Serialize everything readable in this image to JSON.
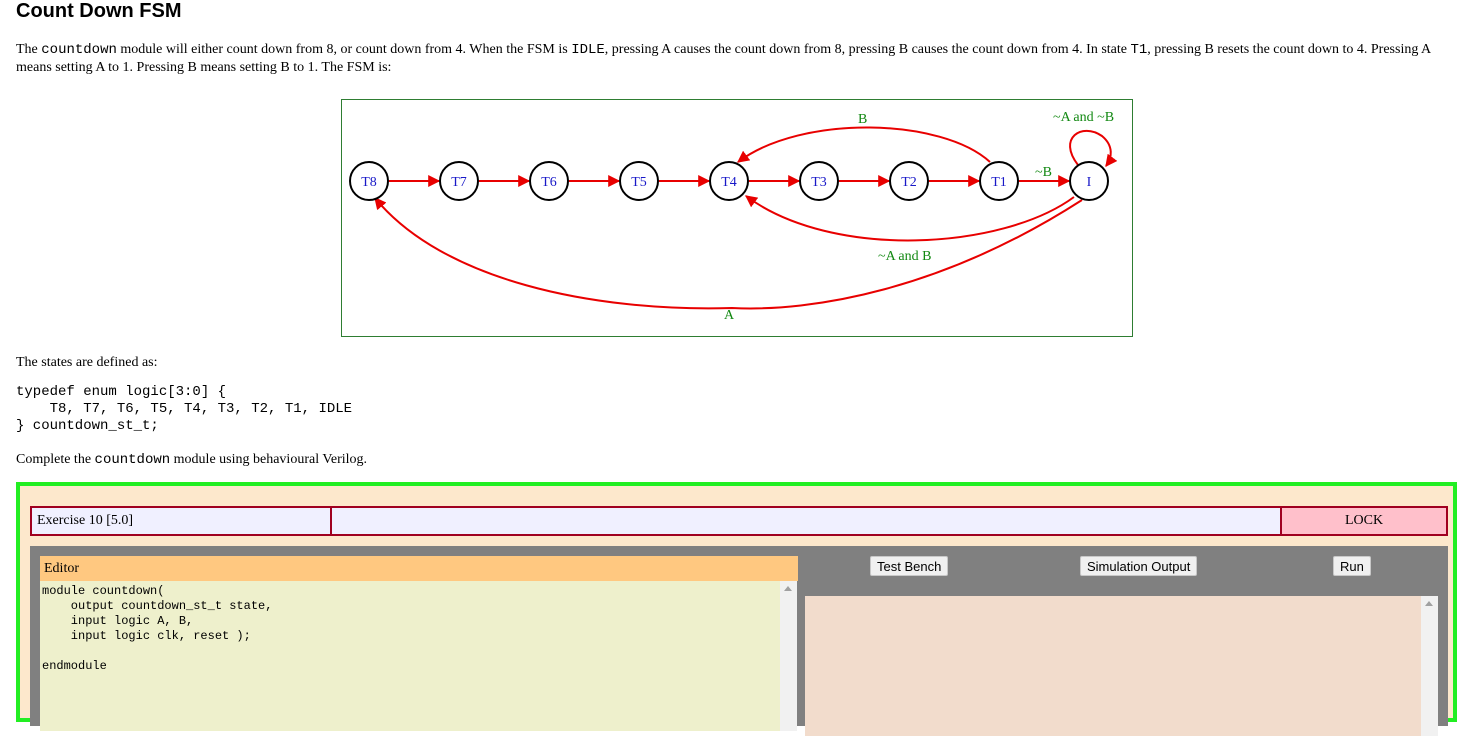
{
  "page": {
    "title": "Count Down FSM",
    "intro": {
      "p1": "The ",
      "code1": "countdown",
      "p2": " module will either count down from 8, or count down from 4. When the FSM is ",
      "code2": "IDLE",
      "p3": ", pressing A causes the count down from 8, pressing B causes the count down from 4. In state ",
      "code3": "T1",
      "p4": ", pressing B resets the count down to 4. Pressing A means setting A to 1. Pressing B means setting B to 1. The FSM is:"
    },
    "states_label": "The states are defined as:",
    "code_block": "typedef enum logic[3:0] {\n    T8, T7, T6, T5, T4, T3, T2, T1, IDLE\n} countdown_st_t;",
    "complete": {
      "p1": "Complete the ",
      "code": "countdown",
      "p2": " module using behavioural Verilog."
    }
  },
  "fsm": {
    "states": [
      "T8",
      "T7",
      "T6",
      "T5",
      "T4",
      "T3",
      "T2",
      "T1",
      "I"
    ],
    "edge_labels": {
      "t1_to_t4": "B",
      "idle_self": "~A and ~B",
      "t1_to_idle": "~B",
      "idle_to_t4": "~A and B",
      "idle_to_t8": "A"
    }
  },
  "exercise": {
    "title": "Exercise 10 [5.0]",
    "lock_label": "LOCK",
    "editor_label": "Editor",
    "editor_code": "module countdown(\n    output countdown_st_t state,\n    input logic A, B,\n    input logic clk, reset );\n\nendmodule",
    "test_bench_label": "Test Bench",
    "simulation_output_label": "Simulation Output",
    "run_label": "Run"
  },
  "colors": {
    "frame_border": "#22ee22",
    "frame_bg": "#fde8cc",
    "lock_bg": "#ffc0cb",
    "editor_header": "#ffc880",
    "editor_bg": "#eef0cc",
    "output_bg": "#f2dccc",
    "edge": "#e80000",
    "edge_label": "#118811",
    "state_text": "#1818c8"
  }
}
